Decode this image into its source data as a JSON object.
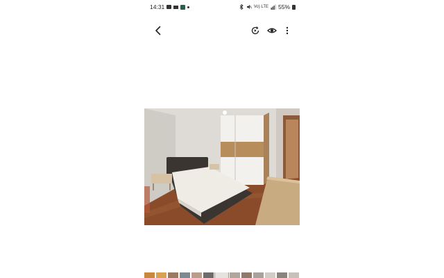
{
  "status_bar": {
    "time": "14:31",
    "network_text": "Vo) LTE",
    "battery_percent": "55%"
  },
  "app_bar": {
    "icons": [
      "back-arrow-icon",
      "remaster-icon",
      "eye-icon",
      "more-vert-icon"
    ]
  },
  "photo": {
    "subject": "bedroom",
    "colors": {
      "wall": "#dedbd6",
      "floor": "#8a4b2a",
      "wardrobe_white": "#f2f1ee",
      "wardrobe_oak": "#b88d5c",
      "mattress": "#efece6",
      "bed_frame": "#3b3532"
    }
  },
  "thumbnails": {
    "colors": [
      "#c9883f",
      "#d8a255",
      "#9b7a62",
      "#7d8a92",
      "#b89c8c",
      "#6e6b6a",
      "#e6e3df",
      "#b0a69b",
      "#8e7a6b",
      "#a9a29b",
      "#d1ccc5",
      "#8a847e",
      "#c7c1ba",
      "#9d968f"
    ],
    "active_index": 6
  }
}
